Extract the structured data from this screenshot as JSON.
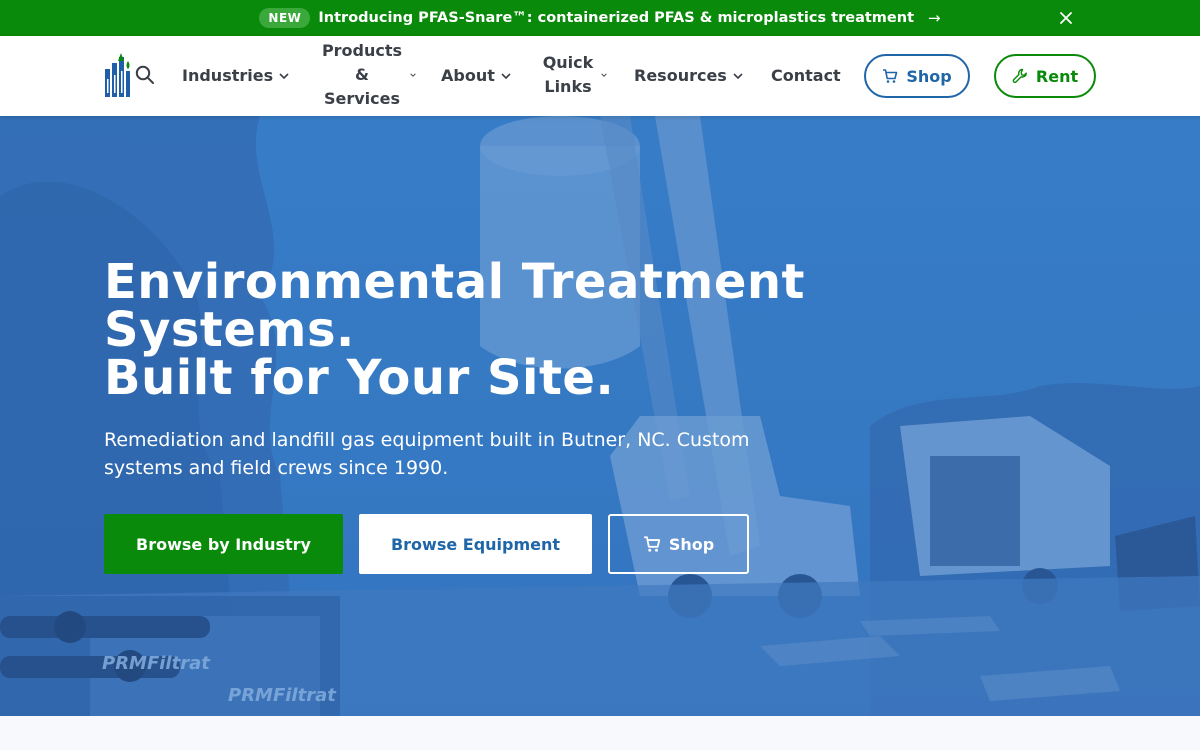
{
  "announcement": {
    "badge": "NEW",
    "message": "Introducing PFAS-Snare™: containerized PFAS & microplastics treatment",
    "arrow": "→"
  },
  "nav": {
    "items": [
      {
        "label": "Industries"
      },
      {
        "label_lines": [
          "Products",
          "&",
          "Services"
        ]
      },
      {
        "label": "About"
      },
      {
        "label_lines": [
          "Quick",
          "Links"
        ]
      },
      {
        "label": "Resources"
      },
      {
        "label": "Contact"
      }
    ],
    "shop_label": "Shop",
    "rent_label": "Rent"
  },
  "hero": {
    "title_lines": [
      "Environmental Treatment",
      "Systems.",
      "Built for Your Site."
    ],
    "subtitle": "Remediation and landfill gas equipment built in Butner, NC. Custom systems and field crews since 1990.",
    "buttons": {
      "industry": "Browse by Industry",
      "equipment": "Browse Equipment",
      "shop": "Shop"
    },
    "image_text": [
      "PRMFiltrat",
      "PRMFiltrat"
    ]
  },
  "colors": {
    "brand_green": "#0a8a0a",
    "brand_blue": "#1f66a8",
    "hero_overlay": "#2f72c4"
  },
  "icons": [
    "search-icon",
    "chevron-down-icon",
    "cart-icon",
    "wrench-icon",
    "close-icon",
    "arrow-right-icon"
  ]
}
